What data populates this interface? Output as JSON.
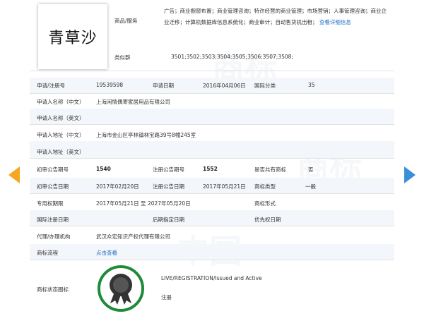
{
  "trademark": {
    "name": "青草沙"
  },
  "goods_services": {
    "label": "商品/服务",
    "text": "广告；商业橱窗布置；商业管理咨询；特许经营的商业管理；市场营销；人事管理咨询；商业企业迁移；计算机数据库信息系统化；商业审计；自动售货机出租；",
    "detail_link": "查看详细信息"
  },
  "similar_group": {
    "label": "类似群",
    "value": "3501;3502;3503;3504;3505;3506;3507;3508;"
  },
  "rows": {
    "reg_no": {
      "label": "申请/注册号",
      "value": "19539598"
    },
    "apply_date": {
      "label": "申请日期",
      "value": "2016年04月06日"
    },
    "intl_class": {
      "label": "国际分类",
      "value": "35"
    },
    "applicant_cn": {
      "label": "申请人名称（中文）",
      "value": "上海闲情偶寄家居用品有限公司"
    },
    "applicant_en": {
      "label": "申请人名称（英文）",
      "value": ""
    },
    "address_cn": {
      "label": "申请人地址（中文）",
      "value": "上海市金山区亭林镇林宝路39号8幢245室"
    },
    "address_en": {
      "label": "申请人地址（英文）",
      "value": ""
    },
    "prelim_no": {
      "label": "初审公告期号",
      "value": "1540"
    },
    "reg_pub_no": {
      "label": "注册公告期号",
      "value": "1552"
    },
    "shared": {
      "label": "是否共有商标",
      "value": "否"
    },
    "prelim_date": {
      "label": "初审公告日期",
      "value": "2017年02月20日"
    },
    "reg_pub_date": {
      "label": "注册公告日期",
      "value": "2017年05月21日"
    },
    "tm_type": {
      "label": "商标类型",
      "value": "一般"
    },
    "exclusive": {
      "label": "专用权期限",
      "value": "2017年05月21日 至 2027年05月20日"
    },
    "tm_form": {
      "label": "商标形式",
      "value": ""
    },
    "intl_reg_date": {
      "label": "国际注册日期",
      "value": ""
    },
    "later_date": {
      "label": "后期指定日期",
      "value": ""
    },
    "priority_date": {
      "label": "优先权日期",
      "value": ""
    },
    "agent": {
      "label": "代理/办理机构",
      "value": "武汉众宏知识产权代理有限公司"
    },
    "process": {
      "label": "商标流程",
      "value": "点击查看"
    },
    "status": {
      "label": "商标状态图标",
      "value": "LIVE/REGISTRATION/Issued and Active",
      "sub": "注册"
    }
  },
  "colors": {
    "left_arrow": "#f5a623",
    "right_arrow": "#3b8ed8",
    "seal": "#1f8a3a",
    "link": "#1f6fc9"
  },
  "icons": {
    "prev": "left-arrow-icon",
    "next": "right-arrow-icon",
    "seal": "registered-seal-icon"
  }
}
